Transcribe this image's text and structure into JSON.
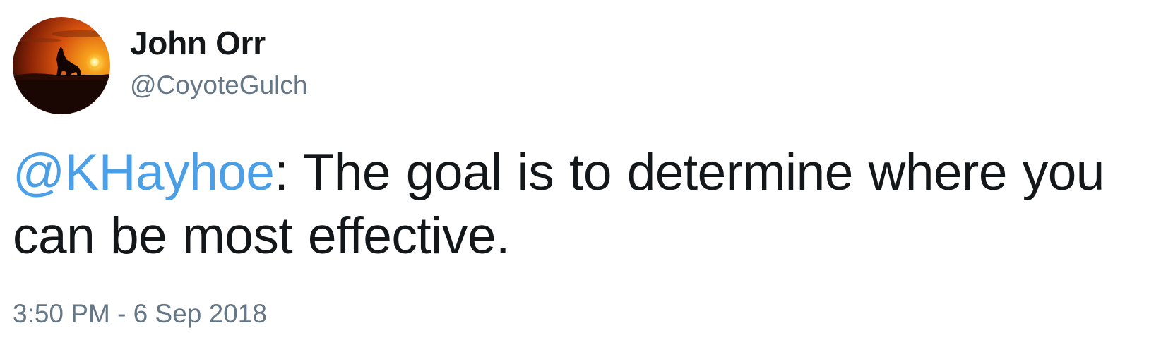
{
  "author": {
    "display_name": "John Orr",
    "handle": "@CoyoteGulch",
    "avatar_icon": "coyote-sunset-avatar"
  },
  "tweet": {
    "mention": "@KHayhoe",
    "text": ": The goal is to determine where you can be most effective.",
    "timestamp": "3:50 PM - 6 Sep 2018"
  },
  "colors": {
    "mention": "#4a9fe6",
    "text": "#14171a",
    "meta": "#657786"
  }
}
